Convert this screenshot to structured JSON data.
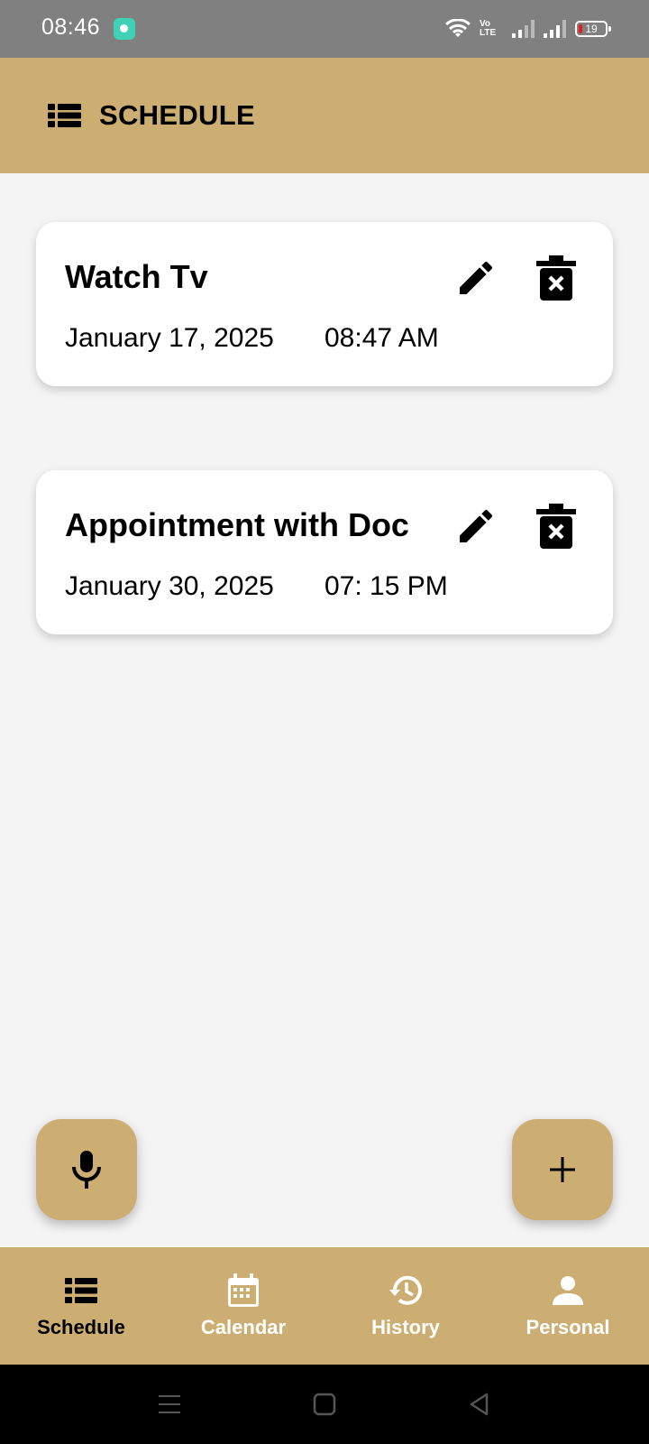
{
  "status_bar": {
    "time": "08:46",
    "network_label": "Vo LTE",
    "battery_level": "19"
  },
  "app_bar": {
    "title": "SCHEDULE",
    "icon": "list-icon"
  },
  "schedules": [
    {
      "title": "Watch Tv",
      "date": "January 17, 2025",
      "time": "08:47 AM"
    },
    {
      "title": "Appointment with Doc",
      "date": "January 30, 2025",
      "time": "07: 15 PM"
    }
  ],
  "card_actions": {
    "edit_icon": "edit-pencil-icon",
    "delete_icon": "delete-icon"
  },
  "fabs": {
    "voice_icon": "microphone-icon",
    "add_icon": "plus-icon"
  },
  "bottom_nav": [
    {
      "label": "Schedule",
      "icon": "list-icon",
      "active": true
    },
    {
      "label": "Calendar",
      "icon": "calendar-icon",
      "active": false
    },
    {
      "label": "History",
      "icon": "history-icon",
      "active": false
    },
    {
      "label": "Personal",
      "icon": "person-icon",
      "active": false
    }
  ],
  "colors": {
    "accent": "#ccae72",
    "status_bar": "#808080",
    "background": "#f4f4f4"
  }
}
